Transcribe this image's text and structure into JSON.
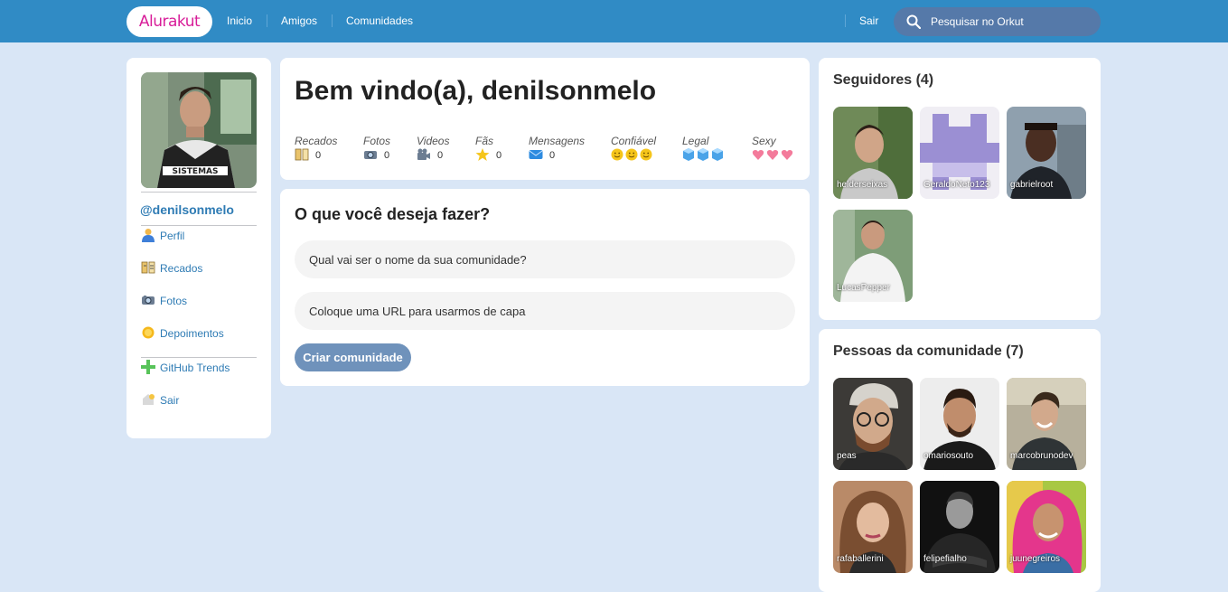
{
  "header": {
    "logo": "Alurakut",
    "nav": [
      "Inicio",
      "Amigos",
      "Comunidades"
    ],
    "logout": "Sair",
    "search_placeholder": "Pesquisar no Orkut",
    "colors": {
      "bar": "#308BC5",
      "logo": "#D81D99"
    }
  },
  "profile": {
    "username": "@denilsonmelo",
    "menu": [
      {
        "label": "Perfil",
        "icon": "user-icon"
      },
      {
        "label": "Recados",
        "icon": "book-icon"
      },
      {
        "label": "Fotos",
        "icon": "camera-icon"
      },
      {
        "label": "Depoimentos",
        "icon": "sun-icon"
      },
      {
        "label": "GitHub Trends",
        "icon": "plus-icon"
      },
      {
        "label": "Sair",
        "icon": "logout-icon"
      }
    ]
  },
  "welcome": {
    "title": "Bem vindo(a), denilsonmelo",
    "stats": [
      {
        "label": "Recados",
        "value": "0",
        "icon": "book-icon"
      },
      {
        "label": "Fotos",
        "value": "0",
        "icon": "camera-icon"
      },
      {
        "label": "Videos",
        "value": "0",
        "icon": "video-camera-icon"
      },
      {
        "label": "Fãs",
        "value": "0",
        "icon": "star-icon"
      },
      {
        "label": "Mensagens",
        "value": "0",
        "icon": "mail-icon"
      }
    ],
    "ratings": [
      {
        "label": "Confiável",
        "icon": "smiley-icon",
        "count": 3
      },
      {
        "label": "Legal",
        "icon": "ice-cube-icon",
        "count": 3
      },
      {
        "label": "Sexy",
        "icon": "heart-icon",
        "count": 3
      }
    ]
  },
  "create_community": {
    "title": "O que você deseja fazer?",
    "name_placeholder": "Qual vai ser o nome da sua comunidade?",
    "url_placeholder": "Coloque uma URL para usarmos de capa",
    "submit": "Criar comunidade"
  },
  "followers": {
    "title": "Seguidores (4)",
    "items": [
      "helderseixas",
      "GeraldoNeto123",
      "gabrielroot",
      "LucasPepper"
    ]
  },
  "community": {
    "title": "Pessoas da comunidade (7)",
    "items": [
      "peas",
      "omariosouto",
      "marcobrunodev",
      "rafaballerini",
      "felipefialho",
      "juunegreiros"
    ]
  }
}
